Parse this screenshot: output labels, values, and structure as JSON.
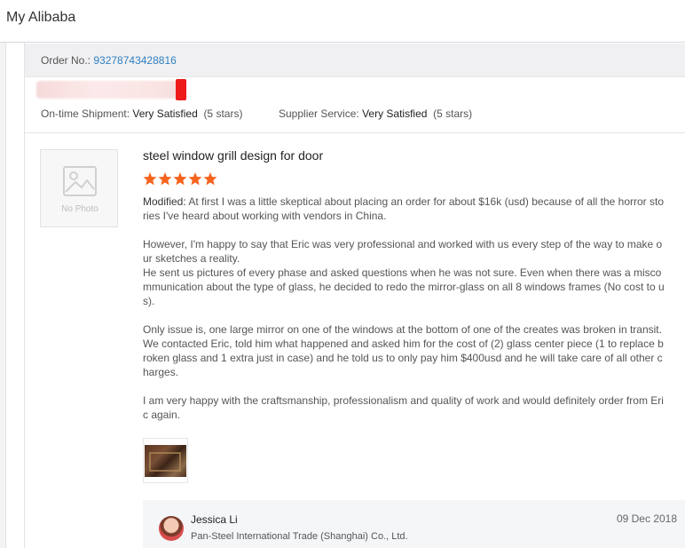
{
  "app": {
    "title": "My Alibaba"
  },
  "order": {
    "label": "Order No.:",
    "number": "93278743428816"
  },
  "ratings": {
    "shipment_label": "On-time Shipment:",
    "shipment_value": "Very Satisfied",
    "shipment_stars": "(5 stars)",
    "service_label": "Supplier Service:",
    "service_value": "Very Satisfied",
    "service_stars": "(5 stars)"
  },
  "review": {
    "thumb_placeholder": "No Photo",
    "product_title": "steel window grill design for door",
    "star_rating": 5,
    "star_color": "#f5641e",
    "modified_label": "Modified:",
    "paragraphs": [
      "At first I was a little skeptical about placing an order for about $16k (usd) because of all the horror stories I've heard about working with vendors in China.",
      "However, I'm happy to say that Eric was very professional and worked with us every step of the way to make our sketches a reality.",
      "He sent us pictures of every phase and asked questions when he was not sure. Even when there was a miscommunication about the type of glass, he decided to redo the mirror-glass on all 8 windows frames (No cost to us).",
      "Only issue is, one large mirror on one of the windows at the bottom of one of the creates was broken in transit. We contacted Eric, told him what happened and asked him for the cost of (2) glass center piece (1 to replace broken glass and 1 extra just in case) and he told us to only pay him $400usd and he will take care of all other charges.",
      "I am very happy with the craftsmanship, professionalism and quality of work and would definitely order from Eric again."
    ]
  },
  "reply": {
    "name": "Jessica Li",
    "company": "Pan-Steel International Trade (Shanghai) Co., Ltd.",
    "date": "09 Dec 2018"
  },
  "colors": {
    "link": "#2f7fc1",
    "star": "#f5641e",
    "redaction": "#ee1b1b"
  }
}
